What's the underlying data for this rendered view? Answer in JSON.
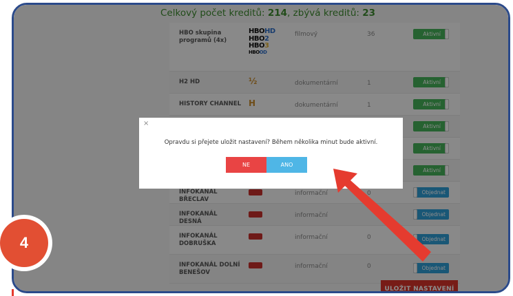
{
  "header": {
    "credits_prefix": "Celkový počet kreditů: ",
    "credits_total": "214",
    "credits_mid": ", zbývá kreditů: ",
    "credits_remaining": "23"
  },
  "channels": [
    {
      "name": "HBO skupina programů (4x)",
      "logo": "hbo-logo",
      "genre": "filmový",
      "count": "36",
      "button": "Aktivní",
      "state": "active"
    },
    {
      "name": "H2 HD",
      "logo": "h2-logo",
      "genre": "dokumentární",
      "count": "1",
      "button": "Aktivní",
      "state": "active"
    },
    {
      "name": "HISTORY CHANNEL",
      "logo": "history-logo",
      "genre": "dokumentární",
      "count": "1",
      "button": "Aktivní",
      "state": "active"
    },
    {
      "name": "",
      "logo": "",
      "genre": "",
      "count": "",
      "button": "Aktivní",
      "state": "active"
    },
    {
      "name": "",
      "logo": "",
      "genre": "",
      "count": "",
      "button": "Aktivní",
      "state": "active"
    },
    {
      "name": "",
      "logo": "",
      "genre": "",
      "count": "",
      "button": "Aktivní",
      "state": "active"
    },
    {
      "name": "INFOKANÁL BŘECLAV",
      "logo": "infokanal-logo",
      "genre": "informační",
      "count": "0",
      "button": "Objednat",
      "state": "order"
    },
    {
      "name": "INFOKANÁL DESNÁ",
      "logo": "infokanal-logo",
      "genre": "informační",
      "count": "",
      "button": "Objednat",
      "state": "order"
    },
    {
      "name": "INFOKANÁL DOBRUŠKA",
      "logo": "infokanal-logo",
      "genre": "informační",
      "count": "0",
      "button": "Objednat",
      "state": "order"
    },
    {
      "name": "INFOKANÁL DOLNÍ BENEŠOV",
      "logo": "infokanal-logo",
      "genre": "informační",
      "count": "0",
      "button": "Objednat",
      "state": "order"
    }
  ],
  "hbo_logo_lines": [
    "HBO",
    "HD",
    "HBO",
    "2",
    "HBO",
    "3",
    "HBO",
    "OD"
  ],
  "save_button": "ULOŽIT NASTAVENÍ",
  "modal": {
    "close": "×",
    "message": "Opravdu si přejete uložit nastavení? Během několika minut bude aktivní.",
    "no_label": "NE",
    "yes_label": "ANO"
  },
  "step_number": "4",
  "colors": {
    "active_green": "#46b35a",
    "order_blue": "#2f9fd8",
    "save_red": "#d9342b",
    "no_red": "#e94444",
    "yes_blue": "#4fb6e6",
    "arrow_red": "#e53b2f",
    "step_badge": "#e24f33",
    "frame_blue": "#2b4a8a",
    "credits_green": "#3c8a2e"
  }
}
